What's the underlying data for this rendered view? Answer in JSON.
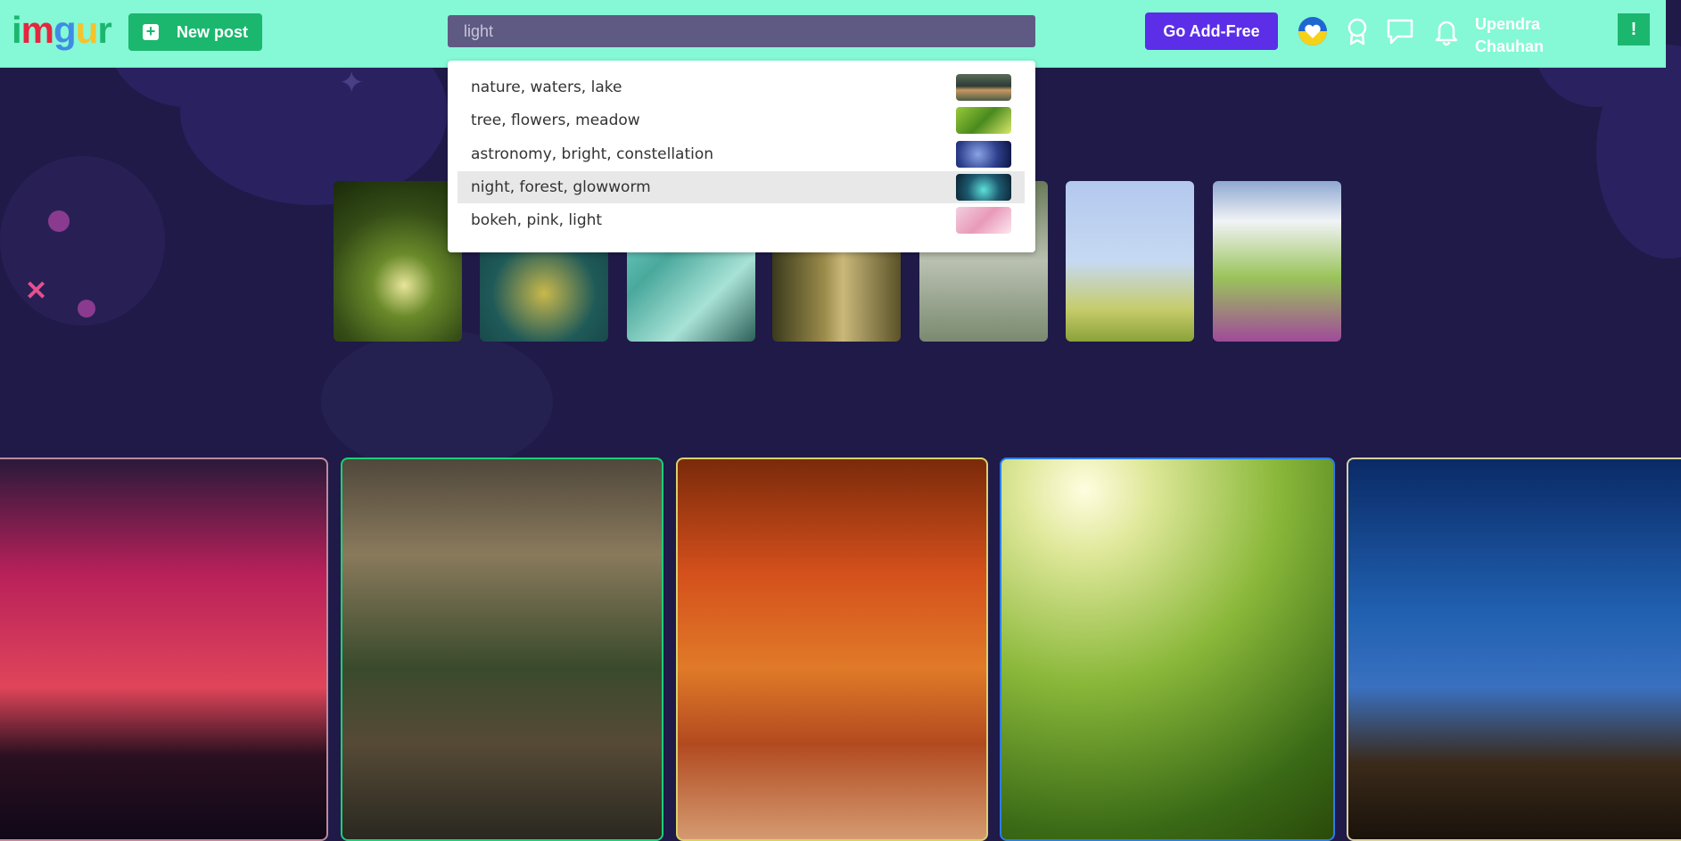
{
  "header": {
    "logo_text": [
      "i",
      "m",
      "g",
      "u",
      "r"
    ],
    "new_post_label": "New post",
    "search": {
      "value": "light",
      "placeholder": ""
    },
    "go_adfree_label": "Go Add-Free",
    "username": [
      "Upendra",
      "Chauhan"
    ],
    "avatar_letter": "!"
  },
  "search_suggestions": [
    {
      "label": "nature, waters, lake",
      "icon": "lake-thumbnail"
    },
    {
      "label": "tree, flowers, meadow",
      "icon": "meadow-thumbnail"
    },
    {
      "label": "astronomy, bright, constellation",
      "icon": "constellation-thumbnail"
    },
    {
      "label": "night, forest, glowworm",
      "icon": "glowworm-thumbnail",
      "highlighted": true
    },
    {
      "label": "bokeh, pink, light",
      "icon": "bokeh-thumbnail"
    }
  ],
  "colors": {
    "header_bg": "#85f8d5",
    "page_bg": "#1f1a48",
    "new_post_green": "#1bb76e",
    "go_adfree_purple": "#5c2ee8"
  }
}
